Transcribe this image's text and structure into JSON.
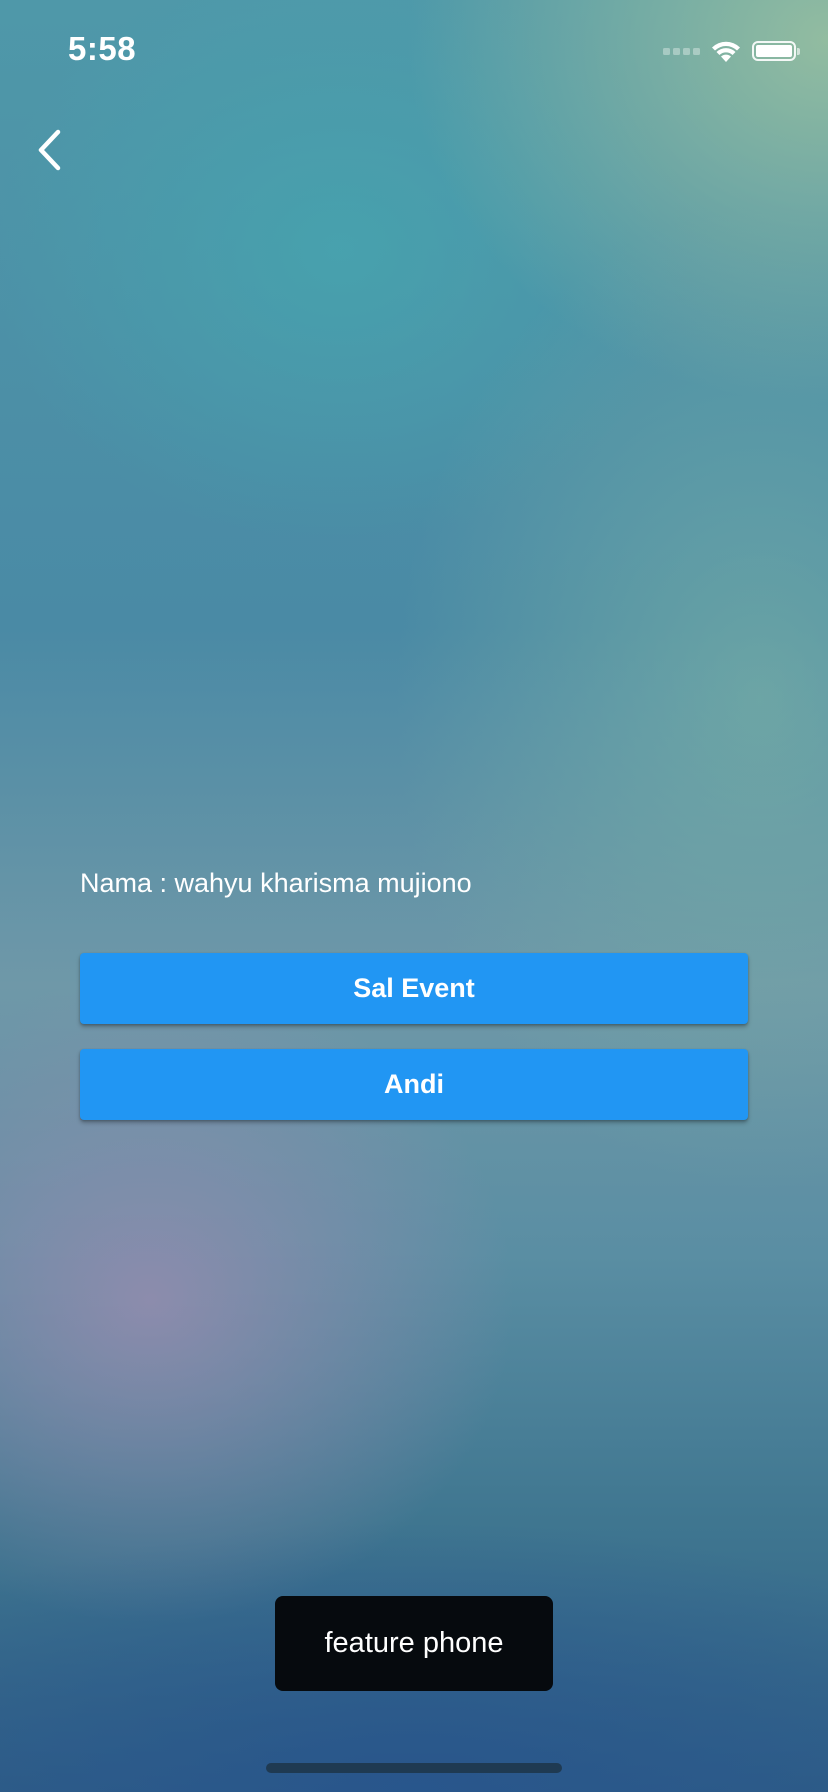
{
  "status_bar": {
    "time": "5:58",
    "signal_icon": "cellular-signal-icon",
    "wifi_icon": "wifi-icon",
    "battery_icon": "battery-icon"
  },
  "nav": {
    "back_icon": "chevron-left-icon"
  },
  "main": {
    "name_text": "Nama : wahyu kharisma mujiono",
    "buttons": [
      {
        "label": "Sal Event"
      },
      {
        "label": "Andi"
      }
    ],
    "button_color": "#2196f3"
  },
  "toast": {
    "message": "feature phone"
  }
}
